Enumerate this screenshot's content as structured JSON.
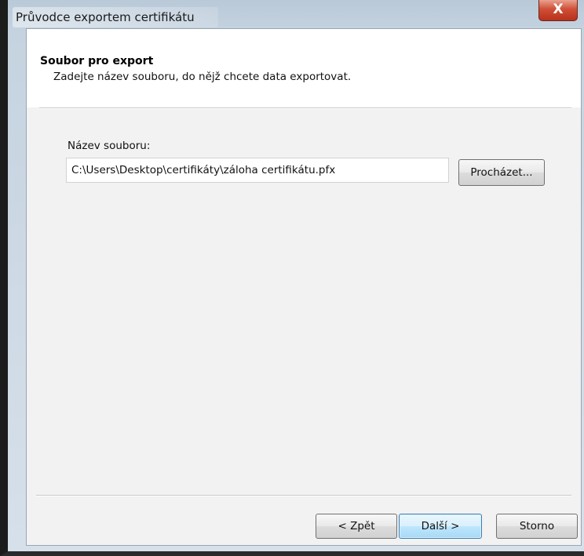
{
  "window": {
    "title": "Průvodce exportem certifikátu",
    "close_label": "X"
  },
  "header": {
    "title": "Soubor pro export",
    "subtitle": "Zadejte název souboru, do nějž chcete data exportovat."
  },
  "form": {
    "file_label": "Název souboru:",
    "file_value": "C:\\Users\\Desktop\\certifikáty\\záloha certifikátu.pfx",
    "browse_label": "Procházet..."
  },
  "footer": {
    "back_label": "< Zpět",
    "next_label": "Další >",
    "cancel_label": "Storno"
  },
  "colors": {
    "close_button": "#cf4f36",
    "default_button": "#bee6fd",
    "frame": "#c5d3e0"
  }
}
